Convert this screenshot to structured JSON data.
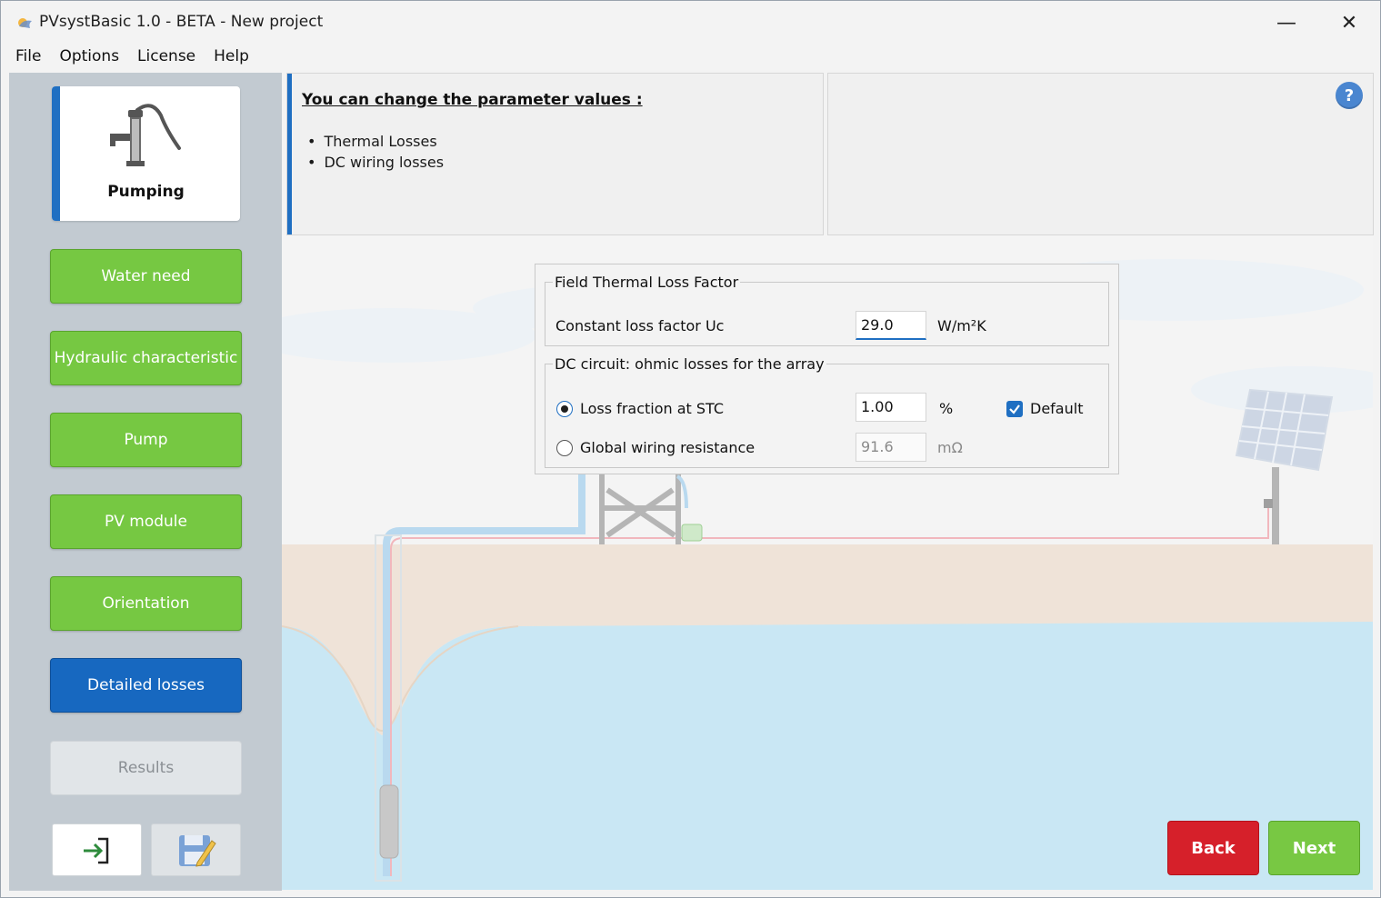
{
  "window": {
    "title": "PVsystBasic 1.0 - BETA - New project",
    "minimize_glyph": "—",
    "close_glyph": "✕"
  },
  "menu": [
    "File",
    "Options",
    "License",
    "Help"
  ],
  "sidebar": {
    "header_card": {
      "label": "Pumping",
      "icon": "water-pump-icon"
    },
    "steps": [
      {
        "label": "Water need",
        "state": "completed"
      },
      {
        "label": "Hydraulic characteristic",
        "state": "completed"
      },
      {
        "label": "Pump",
        "state": "completed"
      },
      {
        "label": "PV module",
        "state": "completed"
      },
      {
        "label": "Orientation",
        "state": "completed"
      },
      {
        "label": "Detailed losses",
        "state": "active"
      },
      {
        "label": "Results",
        "state": "disabled"
      }
    ],
    "bottom_icons": [
      "exit-icon",
      "save-icon"
    ]
  },
  "info": {
    "heading": "You can change the parameter values :",
    "items": [
      "Thermal Losses",
      "DC wiring losses"
    ],
    "help_glyph": "?"
  },
  "dialog": {
    "thermal_group": {
      "legend": "Field Thermal Loss Factor",
      "uc_label": "Constant loss factor Uc",
      "uc_value": "29.0",
      "uc_unit": "W/m²K"
    },
    "dc_group": {
      "legend": "DC circuit: ohmic losses for the array",
      "loss_fraction_label": "Loss fraction at STC",
      "loss_fraction_value": "1.00",
      "loss_fraction_unit": "%",
      "default_label": "Default",
      "default_checked": true,
      "resistance_label": "Global wiring resistance",
      "resistance_value": "91.6",
      "resistance_unit": "mΩ",
      "selected_option": "Loss fraction at STC"
    }
  },
  "nav": {
    "back_label": "Back",
    "next_label": "Next"
  },
  "colors": {
    "accent_blue": "#1768c0",
    "step_green": "#76c842",
    "back_red": "#d6202a",
    "sidebar_bg": "#c2cad1",
    "ground": "#ede3d8",
    "water": "#c9e7f4"
  }
}
